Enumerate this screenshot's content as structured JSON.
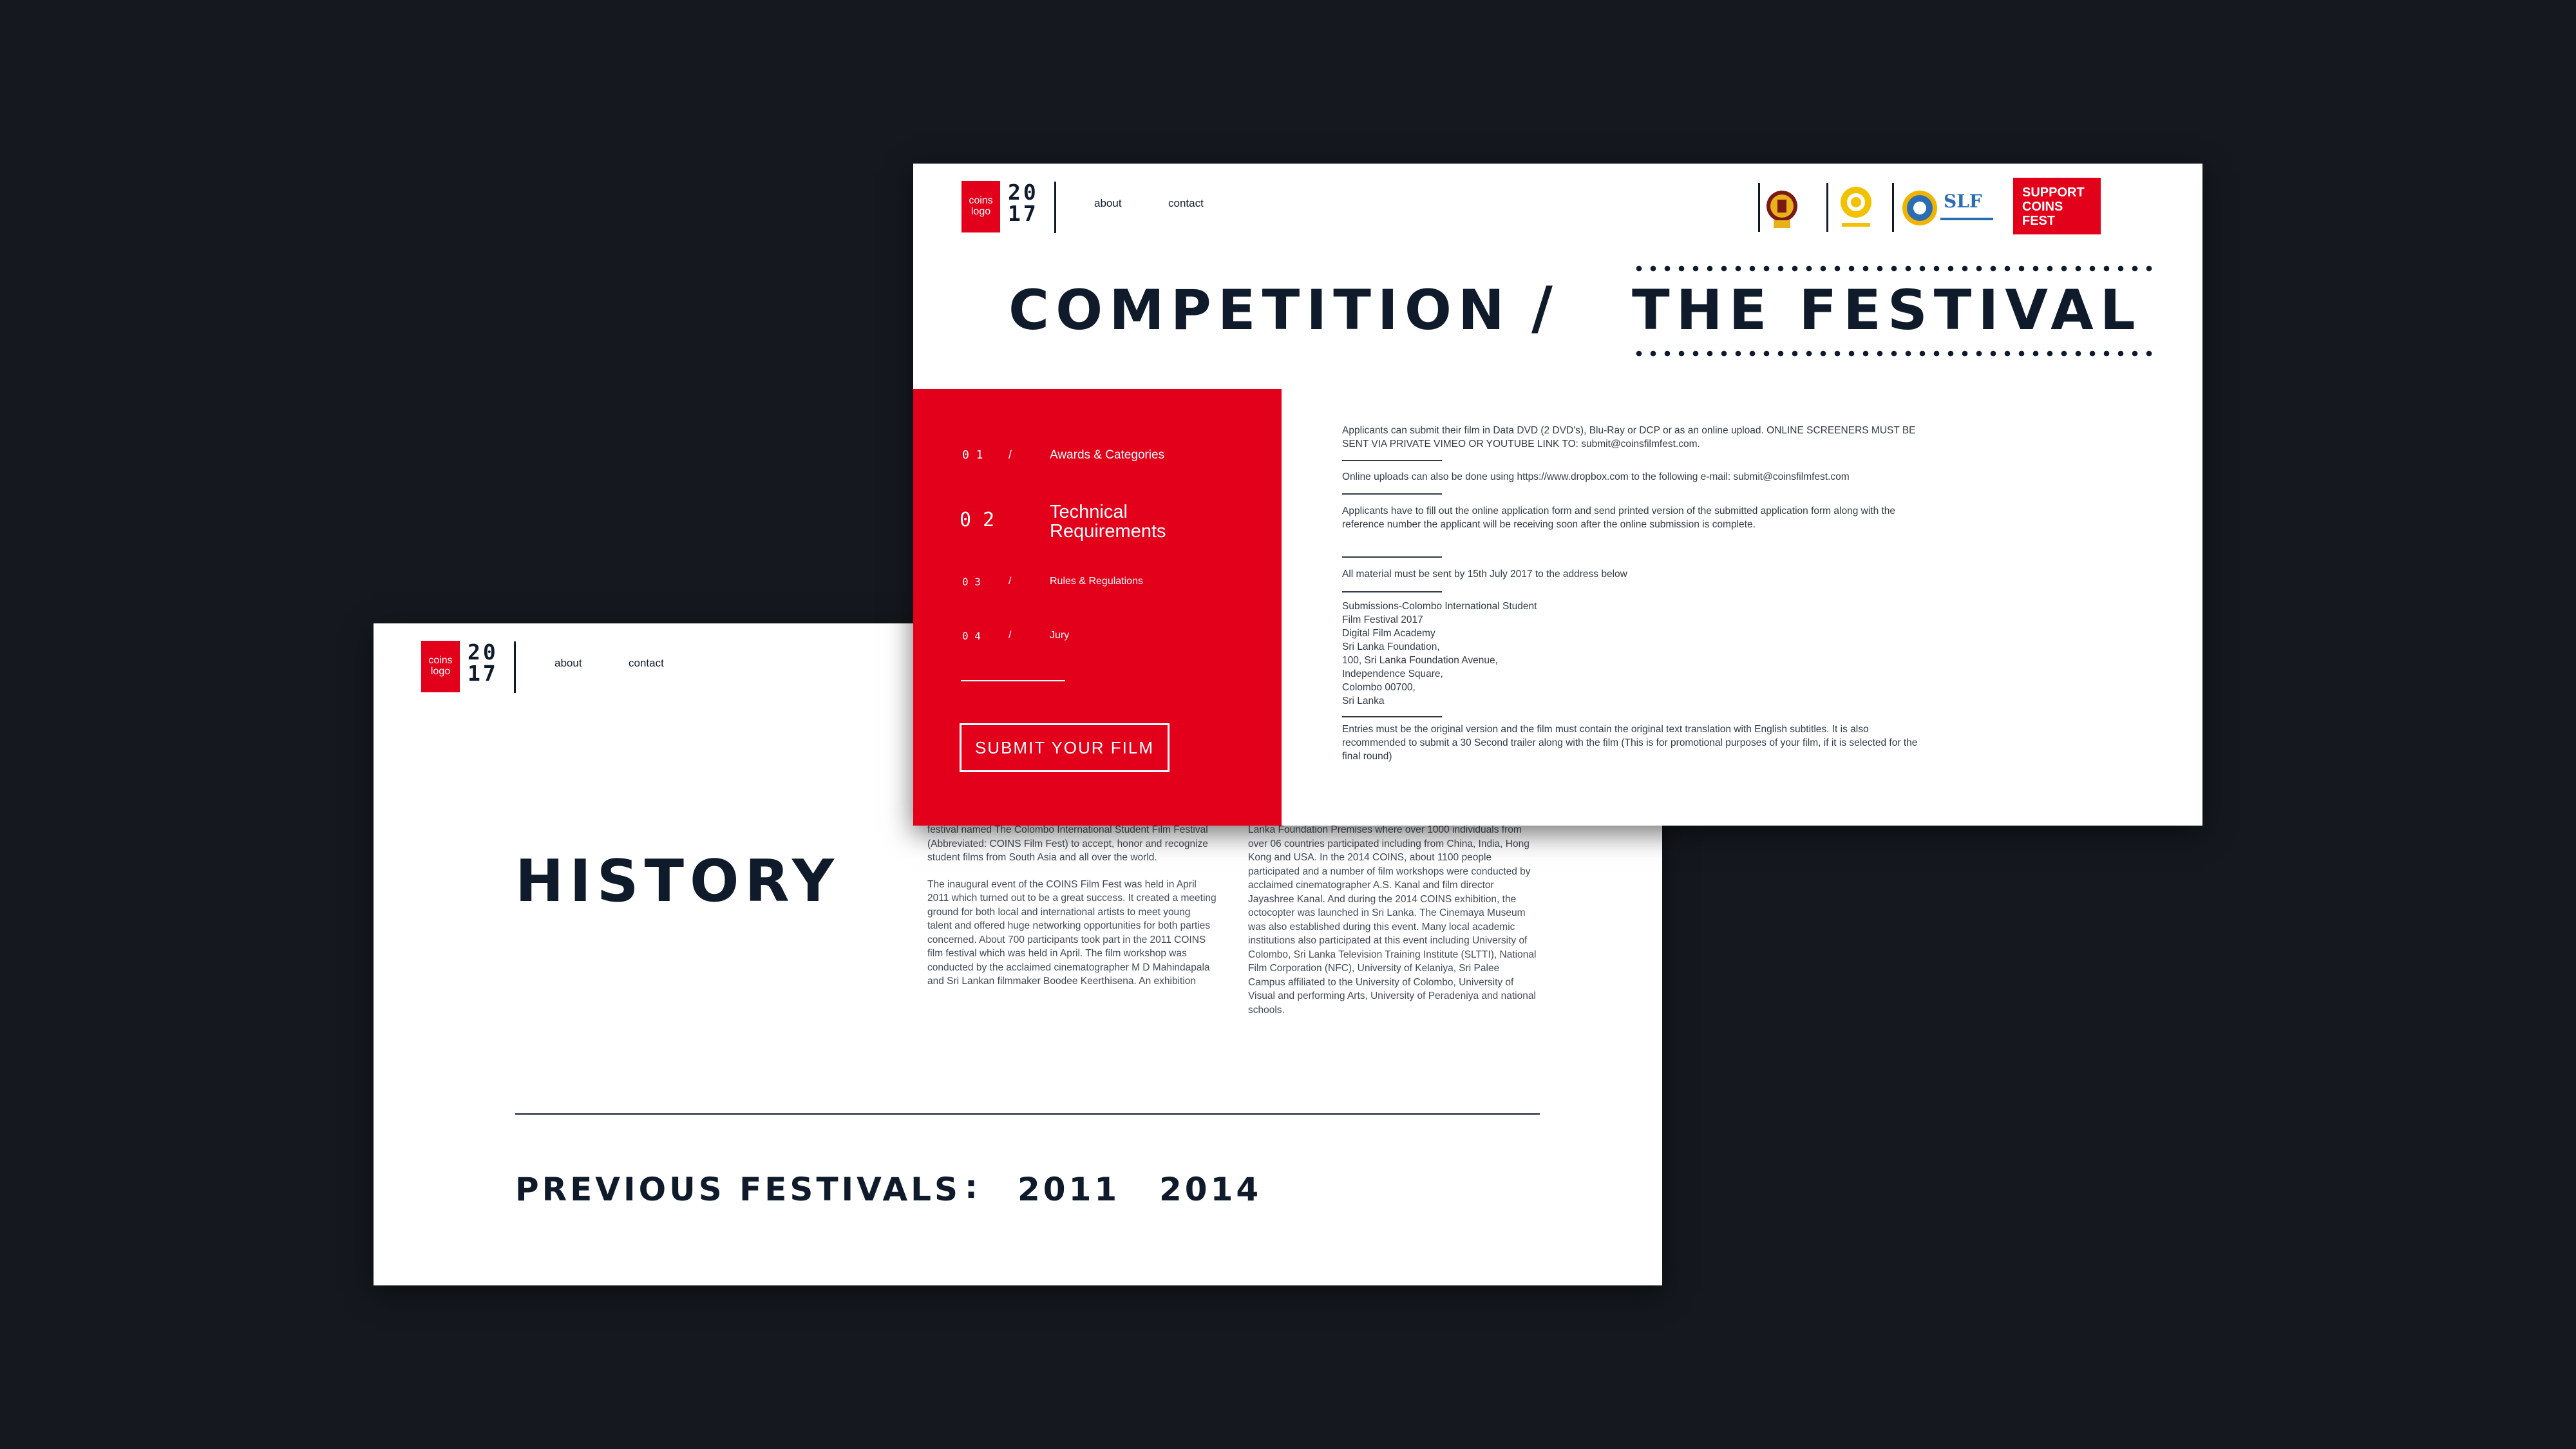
{
  "logo": {
    "text": "coins logo",
    "year_top": "20",
    "year_bottom": "17"
  },
  "nav": {
    "about": "about",
    "contact": "contact"
  },
  "history": {
    "title": "HISTORY",
    "col1": [
      "festival named The Colombo International Student Film Festival (Abbreviated: COINS Film Fest) to accept, honor and recognize student films from South Asia and all over the world.",
      "The inaugural event of the COINS Film Fest was held in April 2011 which turned out to be a great success. It created a meeting ground for both local and international artists to meet young talent and offered huge networking opportunities for both parties concerned. About 700 participants took part in the 2011 COINS film festival which was held in April. The film workshop was conducted by the acclaimed cinematographer M D Mahindapala and Sri Lankan filmmaker Boodee Keerthisena. An exhibition"
    ],
    "col2": [
      "Lanka Foundation Premises where over 1000 individuals from over 06 countries participated including from China, India, Hong Kong and USA. In the 2014 COINS, about 1100 people participated and a number of film workshops were conducted by acclaimed cinematographer A.S. Kanal and film director Jayashree Kanal. And during the 2014 COINS exhibition, the octocopter was launched in Sri Lanka. The Cinemaya Museum was also established during this event. Many local academic institutions also participated at this event including University of Colombo, Sri Lanka Television Training Institute (SLTTI), National Film Corporation (NFC), University of Kelaniya, Sri Palee Campus affiliated to the University of Colombo, University of Visual and performing Arts, University of Peradeniya and national schools."
    ],
    "previous_label": "PREVIOUS FESTIVALS",
    "colon": ":",
    "years": [
      "2011",
      "2014"
    ]
  },
  "competition": {
    "title_left": "COMPETITION",
    "slash": "/",
    "title_right": "THE FESTIVAL",
    "partners": {
      "slf": "SLF",
      "academy": "DIGITAL FILM ACADEMY"
    },
    "support": {
      "line1": "SUPPORT",
      "line2": "COINS",
      "line3": "FEST"
    },
    "menu": [
      {
        "num": "0 1",
        "slash": "/",
        "label": "Awards & Categories"
      },
      {
        "num": "0 2",
        "label_line1": "Technical",
        "label_line2": "Requirements"
      },
      {
        "num": "0 3",
        "slash": "/",
        "label": "Rules & Regulations"
      },
      {
        "num": "0 4",
        "slash": "/",
        "label": "Jury"
      }
    ],
    "submit": "SUBMIT YOUR FILM",
    "content": {
      "p1": "Applicants can submit their film in Data DVD (2 DVD's), Blu-Ray or DCP or as an online upload.  ONLINE SCREENERS MUST BE SENT VIA PRIVATE VIMEO OR YOUTUBE LINK TO: submit@coinsfilmfest.com.",
      "p2": "Online uploads can also be done using https://www.dropbox.com to the following e-mail:   submit@coinsfilmfest.com",
      "p3": "Applicants have to fill out the online application form and send printed version of the submitted application form along with the reference number the applicant will be receiving soon after the online submission is complete.",
      "p4": "All material must be sent by 15th July 2017 to the address below",
      "address": [
        "Submissions-Colombo International Student",
        "Film Festival 2017",
        "Digital Film Academy",
        "Sri Lanka Foundation,",
        "100, Sri Lanka Foundation Avenue,",
        "Independence Square,",
        "Colombo 00700,",
        "Sri Lanka"
      ],
      "p5": "Entries must be the original version and the film must contain the original text translation with English subtitles. It is also recommended to submit a 30 Second trailer along with the film (This is for promotional purposes of your film, if it is selected for the final round)"
    }
  },
  "colors": {
    "red": "#e2001a",
    "navy": "#0f1b2b",
    "background": "#15191f"
  }
}
